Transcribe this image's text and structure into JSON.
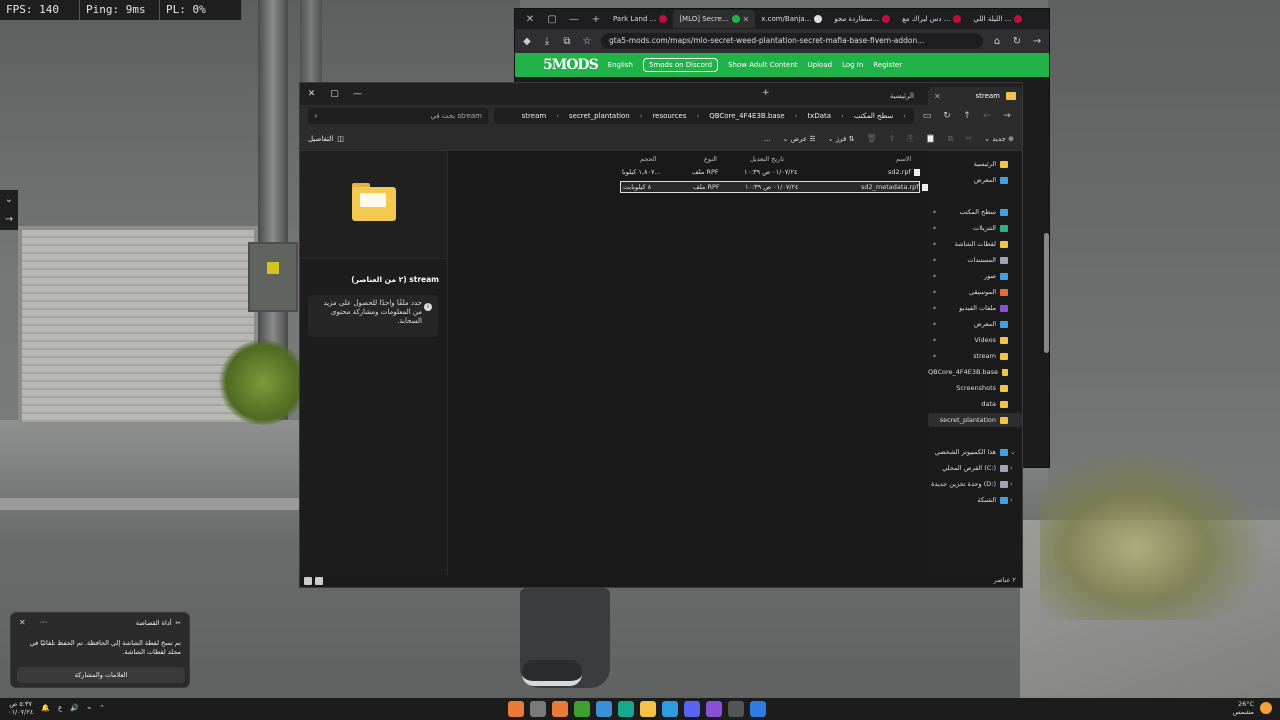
{
  "hud": {
    "fps": "FPS: 140",
    "ping": "Ping: 9ms",
    "pl": "PL: 0%"
  },
  "browser": {
    "tabs": [
      {
        "label": "الليلة اللي ..."
      },
      {
        "label": "دس ليراك مع ..."
      },
      {
        "label": "سطاردة مجو..."
      },
      {
        "label": "x.com/Banja..."
      },
      {
        "label": "[MLO] Secre..."
      },
      {
        "label": "Park Land ..."
      }
    ],
    "url": "gta5-mods.com/maps/mlo-secret-weed-plantation-secret-mafia-base-fivem-addon...",
    "site": {
      "logo": "5MODS",
      "language": "English",
      "discord": "5mods on Discord",
      "adult": "Show Adult Content",
      "upload": "Upload",
      "login": "Log In",
      "register": "Register"
    }
  },
  "explorer": {
    "tab_home": "الرئيسية",
    "tab_stream": "stream",
    "search_placeholder": "بحث في stream",
    "breadcrumbs": [
      "stream",
      "secret_plantation",
      "resources",
      "QBCore_4F4E3B.base",
      "txData",
      "سطح المكتب"
    ],
    "toolbar": {
      "new": "جديد",
      "sort": "فرز",
      "view": "عرض",
      "more": "...",
      "details": "التفاصيل"
    },
    "preview": {
      "title": "stream (٢ من العناصر)",
      "message": "حدد ملفًا واحدًا للحصول على مزيد من المعلومات ومشاركة محتوى السحابة."
    },
    "columns": {
      "name": "الاسم",
      "modified": "تاريخ التعديل",
      "type": "النوع",
      "size": "الحجم"
    },
    "files": [
      {
        "name": "sd2.rpf",
        "modified": "٠١/٠٧/٢٤ ص ١٠:٣٩",
        "type": "ملف RPF",
        "size": "١,٨٠٧ كيلوبا...",
        "selected": false
      },
      {
        "name": "sd2_metadata.rpf",
        "modified": "٠١/٠٧/٢٤ ص ١٠:٣٩",
        "type": "ملف RPF",
        "size": "٨ كيلوبايت",
        "selected": true
      }
    ],
    "sidebar": [
      {
        "label": "الرئيسية",
        "color": "#f1c14a",
        "pinned": false,
        "selected": false
      },
      {
        "label": "المعرض",
        "color": "#3aa3e0",
        "pinned": false,
        "selected": false
      },
      {
        "label": "سطح المكتب",
        "color": "#3aa3e0",
        "pinned": true,
        "selected": false
      },
      {
        "label": "التنزيلات",
        "color": "#2fb37a",
        "pinned": true,
        "selected": false
      },
      {
        "label": "لقطات الشاشة",
        "color": "#f1c14a",
        "pinned": true,
        "selected": false
      },
      {
        "label": "المستندات",
        "color": "#9aa6b8",
        "pinned": true,
        "selected": false
      },
      {
        "label": "صور",
        "color": "#3aa3e0",
        "pinned": true,
        "selected": false
      },
      {
        "label": "الموسيقى",
        "color": "#e86a3a",
        "pinned": true,
        "selected": false
      },
      {
        "label": "ملفات الفيديو",
        "color": "#8a4fd8",
        "pinned": true,
        "selected": false
      },
      {
        "label": "المعرض",
        "color": "#3aa3e0",
        "pinned": true,
        "selected": false
      },
      {
        "label": "Videos",
        "color": "#f1c14a",
        "pinned": true,
        "selected": false
      },
      {
        "label": "stream",
        "color": "#f1c14a",
        "pinned": true,
        "selected": false
      },
      {
        "label": "QBCore_4F4E3B.base",
        "color": "#f1c14a",
        "pinned": false,
        "selected": false
      },
      {
        "label": "Screenshots",
        "color": "#f1c14a",
        "pinned": false,
        "selected": false
      },
      {
        "label": "data",
        "color": "#f1c14a",
        "pinned": false,
        "selected": false
      },
      {
        "label": "secret_plantation",
        "color": "#f1c14a",
        "pinned": false,
        "selected": true
      },
      {
        "label": "هذا الكمبيوتر الشخصي",
        "color": "#3aa3e0",
        "pinned": false,
        "selected": false
      },
      {
        "label": "القرص المحلي (C:)",
        "color": "#9aa6b8",
        "pinned": false,
        "selected": false
      },
      {
        "label": "وحدة تخزين جديدة (D:)",
        "color": "#9aa6b8",
        "pinned": false,
        "selected": false
      },
      {
        "label": "الشبكة",
        "color": "#3aa3e0",
        "pinned": false,
        "selected": false
      }
    ],
    "status_count": "٢ عناصر"
  },
  "toast": {
    "app": "أداة القصاصة",
    "message": "تم نسخ لقطة الشاشة إلى الحافظة. تم الحفظ تلقائيًا في مجلد لقطات الشاشة.",
    "button": "العلامات والمشاركة"
  },
  "taskbar": {
    "time": "٥:٣٧ ص",
    "date": "٠١/٠٧/٢٤",
    "lang": "ع",
    "temp": "26°C",
    "weather": "مشمس",
    "apps": [
      "#e87a3a",
      "#7a7a7a",
      "#e87a3a",
      "#3fa02f",
      "#3b8fd8",
      "#18a88e",
      "#f1c14a",
      "#2f9be0",
      "#5865f2",
      "#8a4fd8",
      "#555555",
      "#2f7ce0"
    ]
  },
  "colors": {
    "mods_green": "#21b24a",
    "folder": "#f2c84f"
  }
}
